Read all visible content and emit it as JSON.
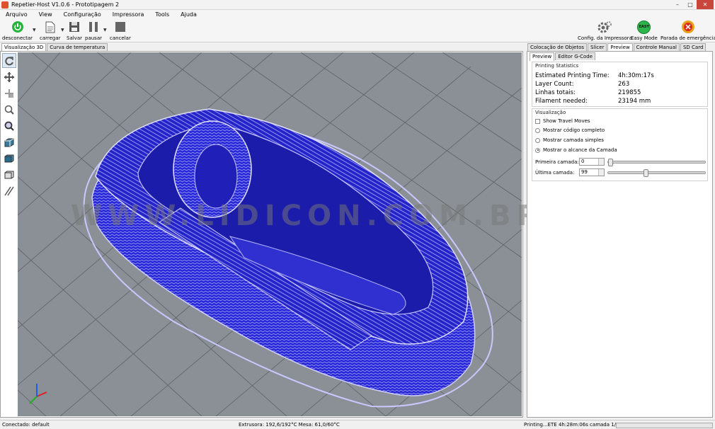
{
  "window": {
    "title": "Repetier-Host V1.0.6 - Prototipagem 2",
    "minimize": "–",
    "maximize": "□",
    "close": "✕"
  },
  "menu": [
    "Arquivo",
    "View",
    "Configuração",
    "Impressora",
    "Tools",
    "Ajuda"
  ],
  "toolbar": {
    "disconnect": "desconectar",
    "load": "carregar",
    "save": "Salvar",
    "pause": "pausar",
    "cancel": "cancelar",
    "printer_config": "Config. da Impressora",
    "easy_mode": "Easy Mode",
    "easy_badge": "EASY",
    "emergency": "Parada de emergência"
  },
  "left_tabs": [
    "Visualização 3D",
    "Curva de temperatura"
  ],
  "right_tabs": [
    "Colocação de Objetos",
    "Slicer",
    "Preview",
    "Controle Manual",
    "SD Card"
  ],
  "sub_tabs": [
    "Preview",
    "Editor G-Code"
  ],
  "stats": {
    "title": "Printing Statistics",
    "rows": [
      {
        "label": "Estimated Printing Time:",
        "value": "4h:30m:17s"
      },
      {
        "label": "Layer Count:",
        "value": "263"
      },
      {
        "label": "Linhas totais:",
        "value": "219855"
      },
      {
        "label": "Filament needed:",
        "value": "23194 mm"
      }
    ]
  },
  "visual": {
    "title": "Visualização",
    "show_travel": "Show Travel Moves",
    "opt_full": "Mostrar código completo",
    "opt_single": "Mostrar camada simples",
    "opt_range": "Mostrar o alcance da Camada",
    "first_label": "Primeira camada:",
    "first_value": "0",
    "last_label": "Última camada:",
    "last_value": "99",
    "first_fraction": 0.0,
    "last_fraction": 0.376
  },
  "watermark": "WWW.LIDICON.COM.BR",
  "status": {
    "connection": "Conectado: default",
    "temps": "Extrusora: 192,6/192°C Mesa: 61,0/60°C",
    "printing": "Printing...ETE 4h:28m:06s camada 1/263"
  },
  "colors": {
    "model": "#2626d6",
    "model_dark": "#1a1aa8",
    "grid_bg": "#8a8f95",
    "accent_green": "#25b33a"
  }
}
